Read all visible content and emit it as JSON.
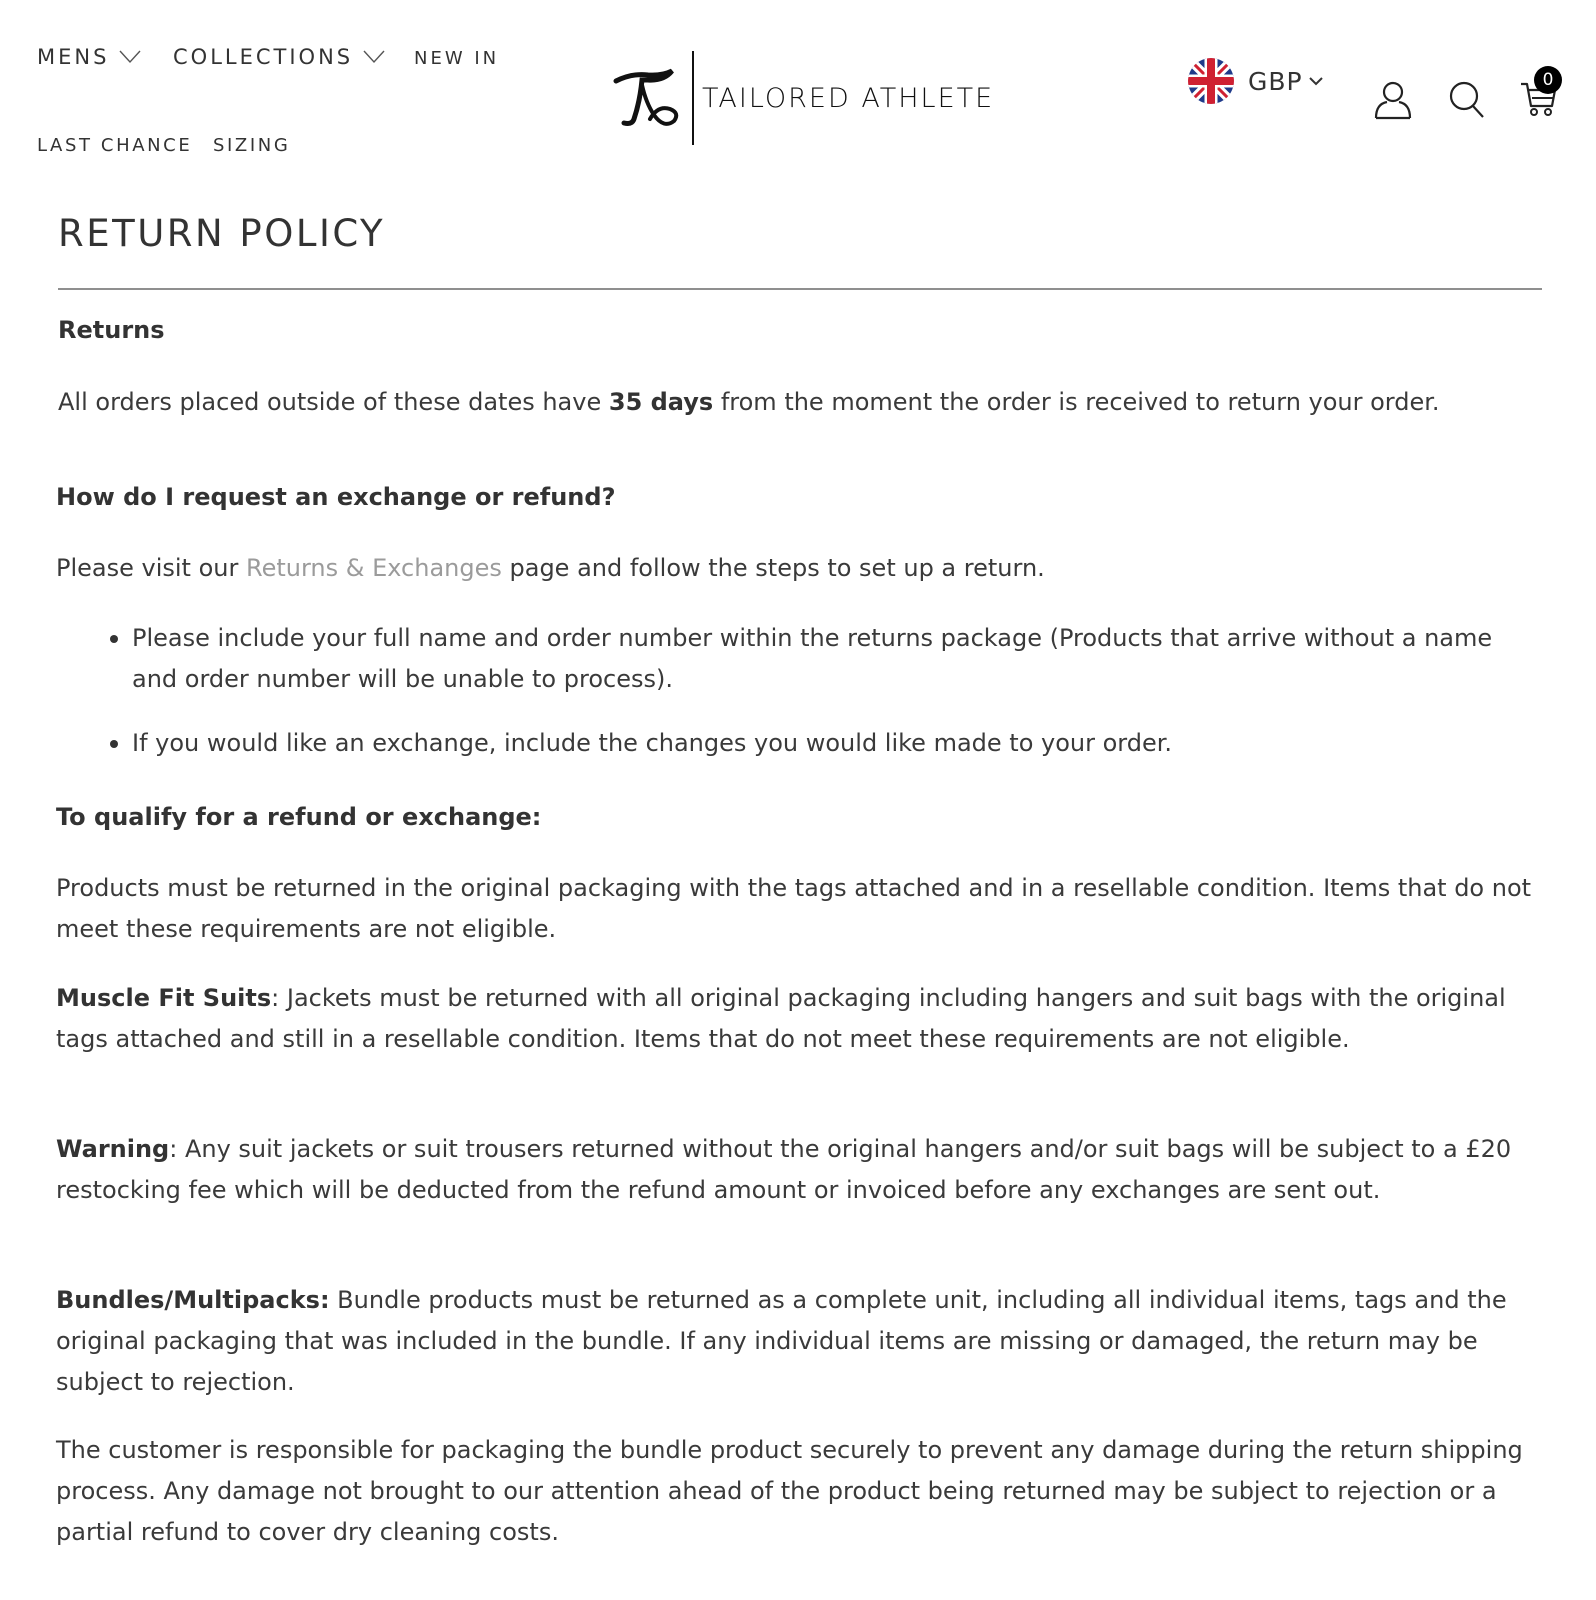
{
  "header": {
    "nav": [
      {
        "label": "MENS",
        "has_dropdown": true
      },
      {
        "label": "COLLECTIONS",
        "has_dropdown": true
      },
      {
        "label": "NEW IN",
        "has_dropdown": false
      },
      {
        "label": "LAST CHANCE",
        "has_dropdown": false
      },
      {
        "label": "SIZING",
        "has_dropdown": false
      }
    ],
    "brand": "TAILORED ATHLETE",
    "currency": {
      "label": "GBP",
      "flag": "uk-flag-icon"
    },
    "icons": {
      "account": "account-icon",
      "search": "search-icon",
      "cart": "cart-icon"
    },
    "cart_count": "0"
  },
  "page": {
    "title": "RETURN POLICY",
    "returns_heading": "Returns",
    "returns_text_pre": "All orders placed outside of these dates have ",
    "returns_text_bold": "35 days",
    "returns_text_post": " from the moment the order is received to return your order.",
    "request_heading": "How do I request an exchange or refund?",
    "request_text_pre": "Please visit our ",
    "request_link": "Returns & Exchanges",
    "request_text_post": " page and follow the steps to set up a return.",
    "bullets": [
      "Please include your full name and order number within the returns package (Products that arrive without a name and order number will be unable to process).",
      "If you would like an exchange, include the changes you would like made to your order."
    ],
    "qualify_heading": "To qualify for a refund or exchange:",
    "qualify_text": "Products must be returned in the original packaging with the tags attached and in a resellable condition. Items that do not meet these requirements are not eligible.",
    "suits_label": "Muscle Fit Suits",
    "suits_text": ": Jackets must be returned with all original packaging including hangers and suit bags with the original tags attached and still in a resellable condition. Items that do not meet these requirements are not eligible.",
    "warning_label": "Warning",
    "warning_text": ": Any suit jackets or suit trousers returned without the original hangers and/or suit bags will be subject to a £20 restocking fee which will be deducted from the refund amount or invoiced before any exchanges are sent out.",
    "bundles_label": "Bundles/Multipacks:",
    "bundles_text": " Bundle products must be returned as a complete unit, including all individual items, tags and the original packaging that was included in the bundle. If any individual items are missing or damaged, the return may be subject to rejection.",
    "customer_text": "The customer is responsible for packaging the bundle product securely to prevent any damage during the return shipping process. Any damage not brought to our attention ahead of the product being returned may be subject to rejection or a partial refund to cover dry cleaning costs."
  },
  "colors": {
    "text": "#3a3a3a",
    "link": "#9b9b9b",
    "divider": "#8f8f8f",
    "badge_bg": "#000000"
  }
}
